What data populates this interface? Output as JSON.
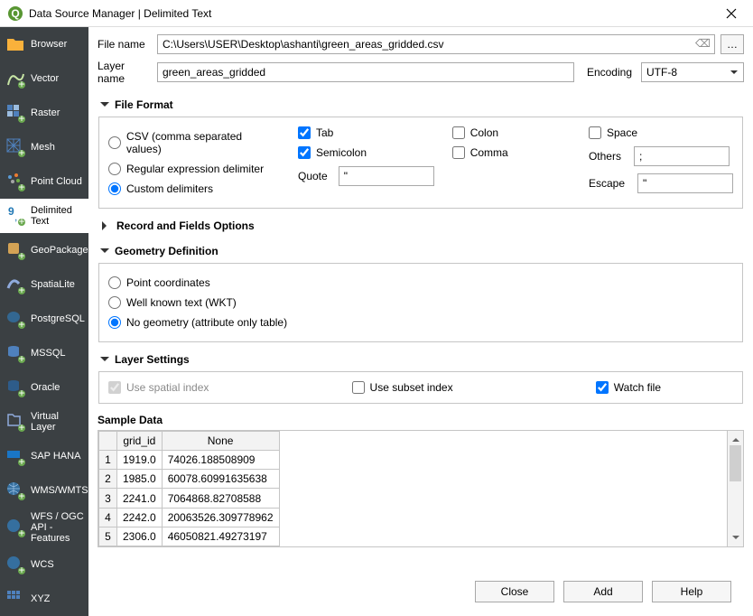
{
  "window": {
    "title": "Data Source Manager | Delimited Text",
    "close_icon": "close"
  },
  "sidebar": {
    "items": [
      {
        "label": "Browser",
        "icon": "browser",
        "selected": false
      },
      {
        "label": "Vector",
        "icon": "vector",
        "selected": false
      },
      {
        "label": "Raster",
        "icon": "raster",
        "selected": false
      },
      {
        "label": "Mesh",
        "icon": "mesh",
        "selected": false
      },
      {
        "label": "Point Cloud",
        "icon": "point-cloud",
        "selected": false
      },
      {
        "label": "Delimited Text",
        "icon": "delimited",
        "selected": true
      },
      {
        "label": "GeoPackage",
        "icon": "geopackage",
        "selected": false
      },
      {
        "label": "SpatiaLite",
        "icon": "spatialite",
        "selected": false
      },
      {
        "label": "PostgreSQL",
        "icon": "postgresql",
        "selected": false
      },
      {
        "label": "MSSQL",
        "icon": "mssql",
        "selected": false
      },
      {
        "label": "Oracle",
        "icon": "oracle",
        "selected": false
      },
      {
        "label": "Virtual Layer",
        "icon": "virtual-layer",
        "selected": false
      },
      {
        "label": "SAP HANA",
        "icon": "sap-hana",
        "selected": false
      },
      {
        "label": "WMS/WMTS",
        "icon": "wms",
        "selected": false
      },
      {
        "label": "WFS / OGC API - Features",
        "icon": "wfs",
        "selected": false
      },
      {
        "label": "WCS",
        "icon": "wcs",
        "selected": false
      },
      {
        "label": "XYZ",
        "icon": "xyz",
        "selected": false
      }
    ]
  },
  "file": {
    "name_label": "File name",
    "name_value": "C:\\Users\\USER\\Desktop\\ashanti\\green_areas_gridded.csv",
    "layer_label": "Layer name",
    "layer_value": "green_areas_gridded",
    "encoding_label": "Encoding",
    "encoding_value": "UTF-8",
    "browse_label": "…"
  },
  "file_format": {
    "title": "File Format",
    "expanded": true,
    "csv_label": "CSV (comma separated values)",
    "regex_label": "Regular expression delimiter",
    "custom_label": "Custom delimiters",
    "selection": "custom",
    "tab": {
      "label": "Tab",
      "checked": true
    },
    "semicolon": {
      "label": "Semicolon",
      "checked": true
    },
    "colon": {
      "label": "Colon",
      "checked": false
    },
    "comma": {
      "label": "Comma",
      "checked": false
    },
    "space": {
      "label": "Space",
      "checked": false
    },
    "others": {
      "label": "Others",
      "value": ";"
    },
    "quote": {
      "label": "Quote",
      "value": "\""
    },
    "escape": {
      "label": "Escape",
      "value": "\""
    }
  },
  "record_fields": {
    "title": "Record and Fields Options",
    "expanded": false
  },
  "geometry": {
    "title": "Geometry Definition",
    "expanded": true,
    "point_label": "Point coordinates",
    "wkt_label": "Well known text (WKT)",
    "none_label": "No geometry (attribute only table)",
    "selection": "none"
  },
  "layer_settings": {
    "title": "Layer Settings",
    "expanded": true,
    "spatial_index": {
      "label": "Use spatial index",
      "checked": true,
      "enabled": false
    },
    "subset_index": {
      "label": "Use subset index",
      "checked": false
    },
    "watch_file": {
      "label": "Watch file",
      "checked": true
    }
  },
  "sample": {
    "title": "Sample Data",
    "columns": [
      "grid_id",
      "None"
    ],
    "rows": [
      {
        "n": "1",
        "grid_id": "1919.0",
        "none": "74026.188508909"
      },
      {
        "n": "2",
        "grid_id": "1985.0",
        "none": "60078.60991635638"
      },
      {
        "n": "3",
        "grid_id": "2241.0",
        "none": "7064868.82708588"
      },
      {
        "n": "4",
        "grid_id": "2242.0",
        "none": "20063526.309778962"
      },
      {
        "n": "5",
        "grid_id": "2306.0",
        "none": "46050821.49273197"
      }
    ]
  },
  "buttons": {
    "close": "Close",
    "add": "Add",
    "help": "Help"
  }
}
